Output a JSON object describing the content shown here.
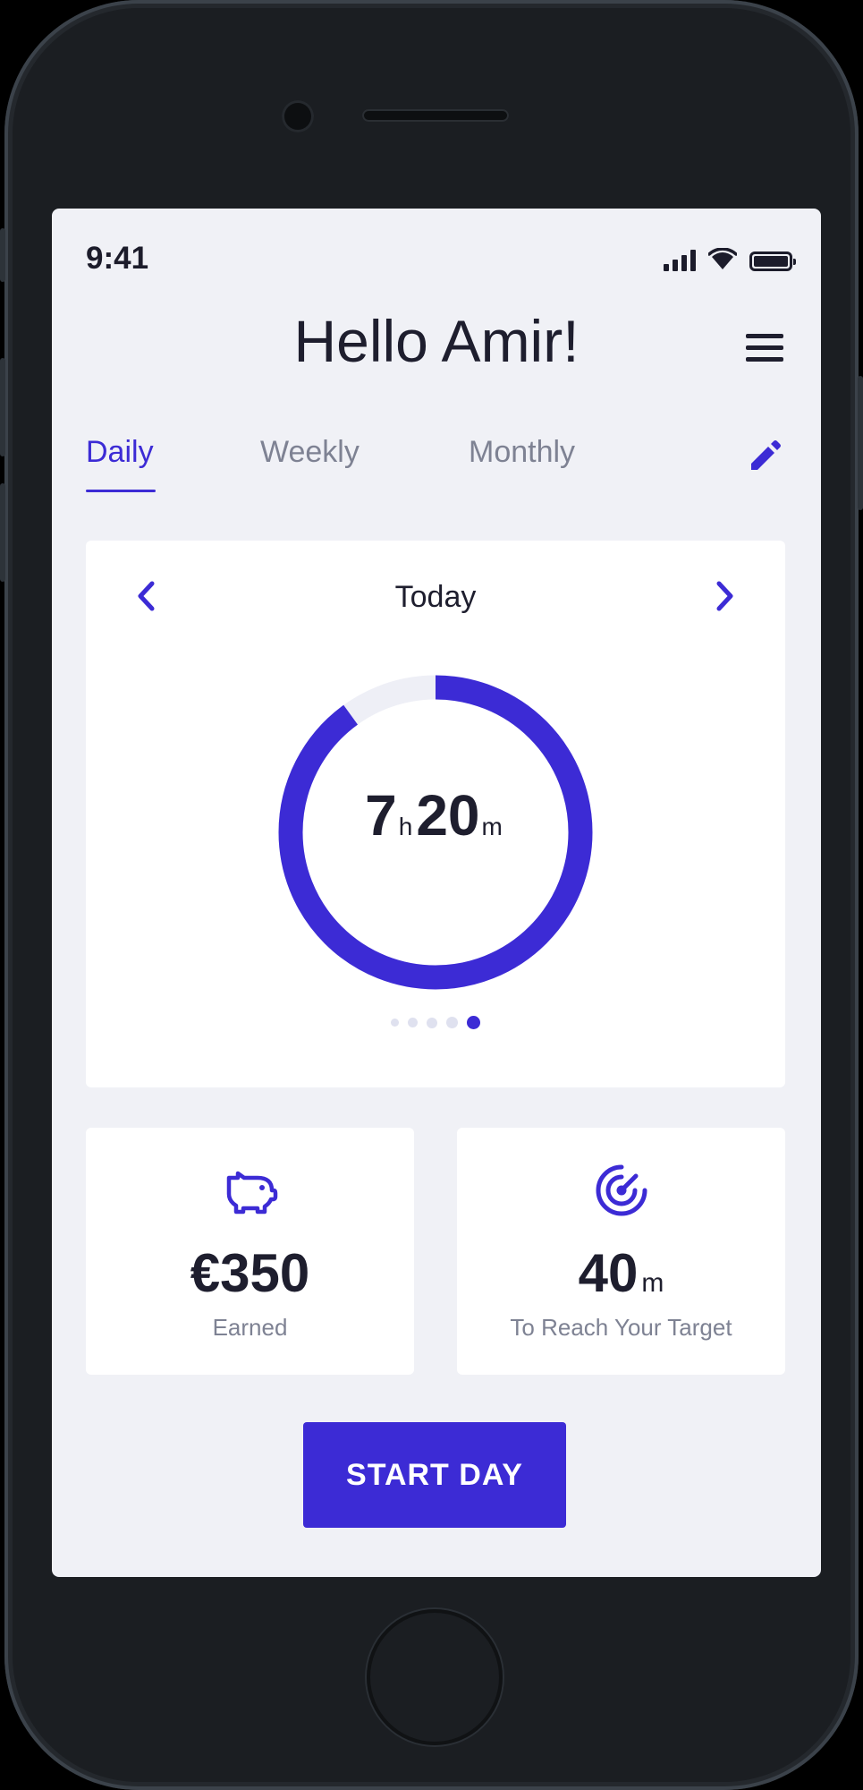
{
  "status_bar": {
    "time": "9:41"
  },
  "header": {
    "greeting": "Hello Amir!"
  },
  "tabs": [
    {
      "label": "Daily",
      "active": true
    },
    {
      "label": "Weekly",
      "active": false
    },
    {
      "label": "Monthly",
      "active": false
    }
  ],
  "today_card": {
    "label": "Today",
    "hours": "7",
    "hours_unit": "h",
    "minutes": "20",
    "minutes_unit": "m",
    "progress_fraction": 0.9,
    "pagination": {
      "count": 5,
      "active_index": 4
    }
  },
  "stats": {
    "earned": {
      "value": "€350",
      "label": "Earned",
      "icon": "piggy-bank-icon"
    },
    "target": {
      "value": "40",
      "unit": "m",
      "label": "To Reach Your Target",
      "icon": "target-icon"
    }
  },
  "primary_action": {
    "label": "START DAY"
  },
  "colors": {
    "accent": "#3c2bd5",
    "background": "#f0f1f6",
    "ring_track": "#eeeff6",
    "text_primary": "#1e1e2e",
    "text_secondary": "#7e8293"
  }
}
